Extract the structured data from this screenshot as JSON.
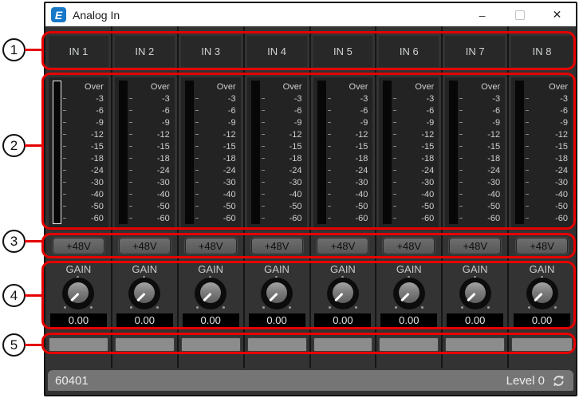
{
  "window": {
    "title": "Analog In",
    "logo_text": "E",
    "controls": {
      "minimize_glyph": "–",
      "close_glyph": "✕"
    }
  },
  "meter_scale": [
    "Over",
    "-3",
    "-6",
    "-9",
    "-12",
    "-15",
    "-18",
    "-24",
    "-30",
    "-40",
    "-50",
    "-60"
  ],
  "channels": [
    {
      "label": "IN 1",
      "phantom_label": "+48V",
      "gain_label": "GAIN",
      "gain_value": "0.00",
      "port_name": ""
    },
    {
      "label": "IN 2",
      "phantom_label": "+48V",
      "gain_label": "GAIN",
      "gain_value": "0.00",
      "port_name": ""
    },
    {
      "label": "IN 3",
      "phantom_label": "+48V",
      "gain_label": "GAIN",
      "gain_value": "0.00",
      "port_name": ""
    },
    {
      "label": "IN 4",
      "phantom_label": "+48V",
      "gain_label": "GAIN",
      "gain_value": "0.00",
      "port_name": ""
    },
    {
      "label": "IN 5",
      "phantom_label": "+48V",
      "gain_label": "GAIN",
      "gain_value": "0.00",
      "port_name": ""
    },
    {
      "label": "IN 6",
      "phantom_label": "+48V",
      "gain_label": "GAIN",
      "gain_value": "0.00",
      "port_name": ""
    },
    {
      "label": "IN 7",
      "phantom_label": "+48V",
      "gain_label": "GAIN",
      "gain_value": "0.00",
      "port_name": ""
    },
    {
      "label": "IN 8",
      "phantom_label": "+48V",
      "gain_label": "GAIN",
      "gain_value": "0.00",
      "port_name": ""
    }
  ],
  "status_bar": {
    "device_id": "60401",
    "level_label": "Level 0",
    "refresh_icon": "refresh-sync"
  },
  "annotations": [
    {
      "num": "1"
    },
    {
      "num": "2"
    },
    {
      "num": "3"
    },
    {
      "num": "4"
    },
    {
      "num": "5"
    }
  ],
  "colors": {
    "annotation_red": "#e60000",
    "logo_blue": "#1778c8",
    "statusbar_gray": "#757575",
    "content_dark": "#333333"
  }
}
